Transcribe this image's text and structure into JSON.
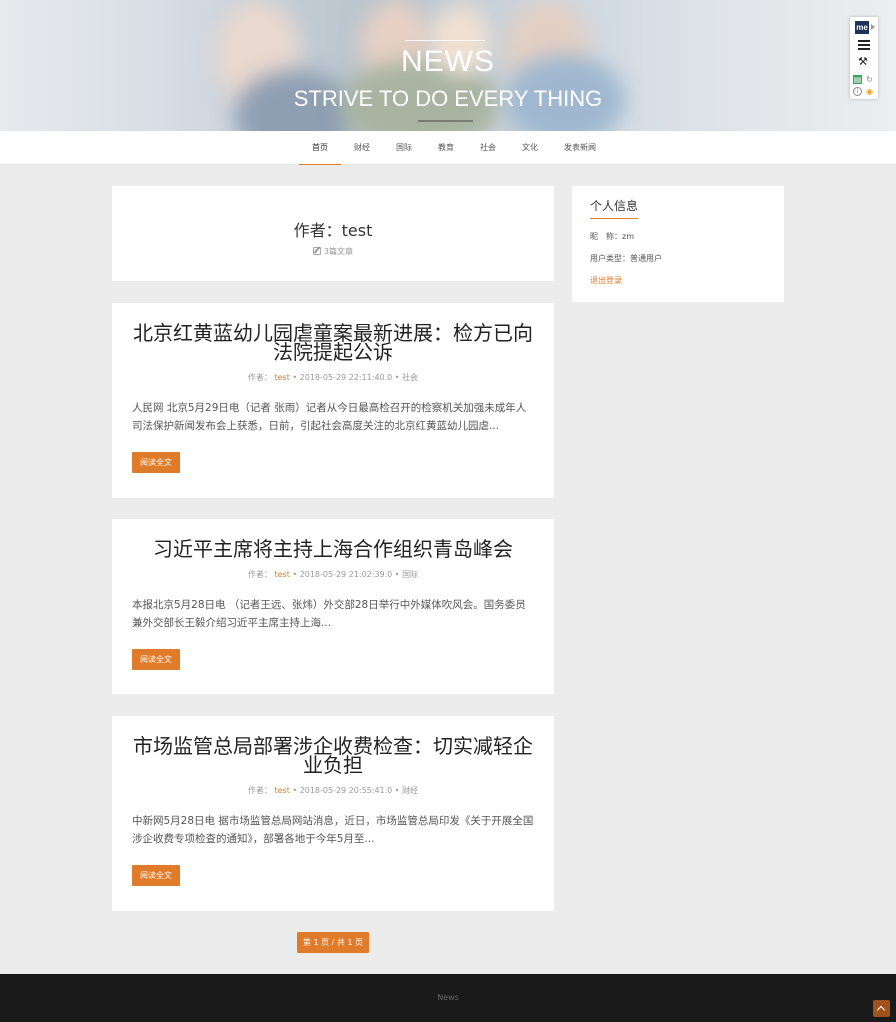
{
  "banner": {
    "title": "NEWS",
    "subtitle": "STRIVE TO DO EVERY THING"
  },
  "toolbar": {
    "logo_text": "me"
  },
  "nav": {
    "items": [
      {
        "label": "首页",
        "active": true
      },
      {
        "label": "财经"
      },
      {
        "label": "国际"
      },
      {
        "label": "教育"
      },
      {
        "label": "社会"
      },
      {
        "label": "文化"
      },
      {
        "label": "发表新闻"
      }
    ]
  },
  "author_box": {
    "heading": "作者：test",
    "count": "3篇文章"
  },
  "articles": [
    {
      "title": "北京红黄蓝幼儿园虐童案最新进展：检方已向法院提起公诉",
      "author_label": "作者：",
      "author": "test",
      "datetime": "• 2018-05-29 22:11:40.0 •",
      "category": "社会",
      "summary": "人民网 北京5月29日电（记者 张雨）记者从今日最高检召开的检察机关加强未成年人司法保护新闻发布会上获悉，日前，引起社会高度关注的北京红黄蓝幼儿园虐...",
      "button": "阅读全文"
    },
    {
      "title": "习近平主席将主持上海合作组织青岛峰会",
      "author_label": "作者：",
      "author": "test",
      "datetime": "• 2018-05-29 21:02:39.0 •",
      "category": "国际",
      "summary": "本报北京5月28日电 （记者王远、张炜）外交部28日举行中外媒体吹风会。国务委员兼外交部长王毅介绍习近平主席主持上海...",
      "button": "阅读全文"
    },
    {
      "title": "市场监管总局部署涉企收费检查：切实减轻企业负担",
      "author_label": "作者：",
      "author": "test",
      "datetime": "• 2018-05-29 20:55:41.0 •",
      "category": "财经",
      "summary": "中新网5月28日电 据市场监管总局网站消息，近日，市场监管总局印发《关于开展全国涉企收费专项检查的通知》，部署各地于今年5月至...",
      "button": "阅读全文"
    }
  ],
  "sidebar": {
    "title": "个人信息",
    "nickname": "昵　称：zm",
    "user_type": "用户类型：普通用户",
    "logout": "退出登录"
  },
  "pager": {
    "label": "第 1 页 / 共 1 页"
  },
  "footer": {
    "text": "News"
  },
  "colors": {
    "accent": "#e07b2a",
    "footer_bg": "#1a1a1a",
    "page_bg": "#ececec"
  }
}
